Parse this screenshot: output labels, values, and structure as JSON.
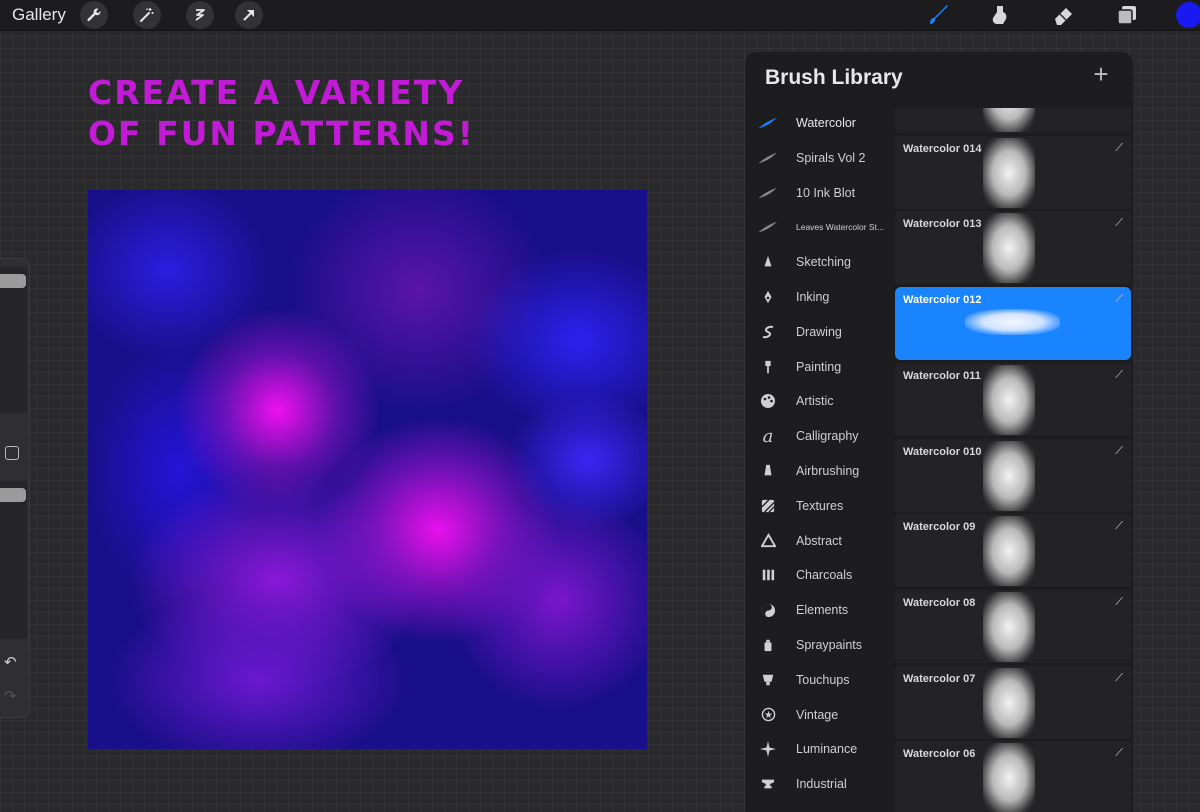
{
  "topbar": {
    "gallery_label": "Gallery",
    "left_tools": [
      "wrench-icon",
      "magic-wand-icon",
      "selection-icon",
      "transform-arrow-icon"
    ],
    "right_tools": [
      "brush-icon",
      "smudge-icon",
      "eraser-icon",
      "layers-icon"
    ],
    "active_tool": "brush-icon",
    "current_color": "#1a1af0"
  },
  "headline": {
    "line1": "CREATE A VARIETY",
    "line2": "OF FUN PATTERNS!",
    "color": "#c21ad6"
  },
  "sidebar": {
    "size_slider_level": 0.95,
    "opacity_slider_level": 0.95,
    "undo_icon": "undo-arrow-icon",
    "redo_icon": "redo-arrow-icon"
  },
  "brush_library": {
    "title": "Brush Library",
    "add_icon": "plus-icon",
    "categories": [
      {
        "label": "Watercolor",
        "icon": "feather-icon",
        "active": true
      },
      {
        "label": "Spirals Vol 2",
        "icon": "feather-icon"
      },
      {
        "label": "10 Ink Blot",
        "icon": "feather-icon"
      },
      {
        "label": "Leaves Watercolor St...",
        "icon": "feather-icon"
      },
      {
        "label": "Sketching",
        "icon": "pencil-tip-icon"
      },
      {
        "label": "Inking",
        "icon": "pen-nib-icon"
      },
      {
        "label": "Drawing",
        "icon": "squiggle-icon"
      },
      {
        "label": "Painting",
        "icon": "paint-brush-icon"
      },
      {
        "label": "Artistic",
        "icon": "palette-icon"
      },
      {
        "label": "Calligraphy",
        "icon": "calligraphy-a-icon"
      },
      {
        "label": "Airbrushing",
        "icon": "airbrush-icon"
      },
      {
        "label": "Textures",
        "icon": "hatch-square-icon"
      },
      {
        "label": "Abstract",
        "icon": "triangle-icon"
      },
      {
        "label": "Charcoals",
        "icon": "charcoal-sticks-icon"
      },
      {
        "label": "Elements",
        "icon": "yin-yang-icon"
      },
      {
        "label": "Spraypaints",
        "icon": "spray-can-icon"
      },
      {
        "label": "Touchups",
        "icon": "touchup-icon"
      },
      {
        "label": "Vintage",
        "icon": "star-circle-icon"
      },
      {
        "label": "Luminance",
        "icon": "sparkle-icon"
      },
      {
        "label": "Industrial",
        "icon": "anvil-icon"
      }
    ],
    "brushes": [
      {
        "name": "",
        "partial": true
      },
      {
        "name": "Watercolor 014"
      },
      {
        "name": "Watercolor 013"
      },
      {
        "name": "Watercolor 012",
        "selected": true
      },
      {
        "name": "Watercolor 011"
      },
      {
        "name": "Watercolor 010"
      },
      {
        "name": "Watercolor 09"
      },
      {
        "name": "Watercolor 08"
      },
      {
        "name": "Watercolor 07"
      },
      {
        "name": "Watercolor 06"
      }
    ]
  },
  "colors": {
    "accent": "#1a84ff",
    "panel": "#1d1d1f",
    "canvas_base": "#1a0f8a",
    "magenta": "#e012e6",
    "violet": "#6a14c8"
  }
}
